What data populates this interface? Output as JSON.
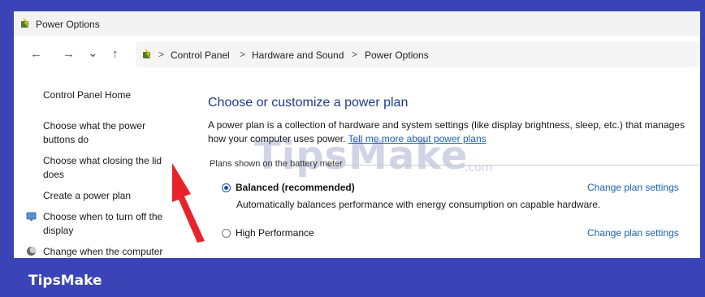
{
  "window": {
    "title": "Power Options"
  },
  "nav": {
    "back": "←",
    "forward": "→",
    "recent": "⌄",
    "up": "↑"
  },
  "breadcrumb": {
    "sep": ">",
    "items": [
      "Control Panel",
      "Hardware and Sound",
      "Power Options"
    ]
  },
  "sidebar": {
    "items": [
      {
        "label": "Control Panel Home"
      },
      {
        "label": "Choose what the power buttons do"
      },
      {
        "label": "Choose what closing the lid does"
      },
      {
        "label": "Create a power plan"
      },
      {
        "label": "Choose when to turn off the display"
      },
      {
        "label": "Change when the computer"
      }
    ]
  },
  "main": {
    "title": "Choose or customize a power plan",
    "desc_part1": "A power plan is a collection of hardware and system settings (like display brightness, sleep, etc.) that manages how your computer uses power. ",
    "desc_link": "Tell me more about power plans",
    "group_label": "Plans shown on the battery meter",
    "plans": [
      {
        "name": "Balanced (recommended)",
        "desc": "Automatically balances performance with energy consumption on capable hardware.",
        "link": "Change plan settings",
        "selected": true
      },
      {
        "name": "High Performance",
        "link": "Change plan settings",
        "selected": false
      }
    ]
  },
  "watermark": {
    "text": "TipsMake",
    "suffix": ".com"
  },
  "footer": {
    "brand": "TipsMake"
  },
  "colors": {
    "accent": "#3a44b6",
    "link": "#1a5fb4",
    "arrow": "#e8232b"
  }
}
